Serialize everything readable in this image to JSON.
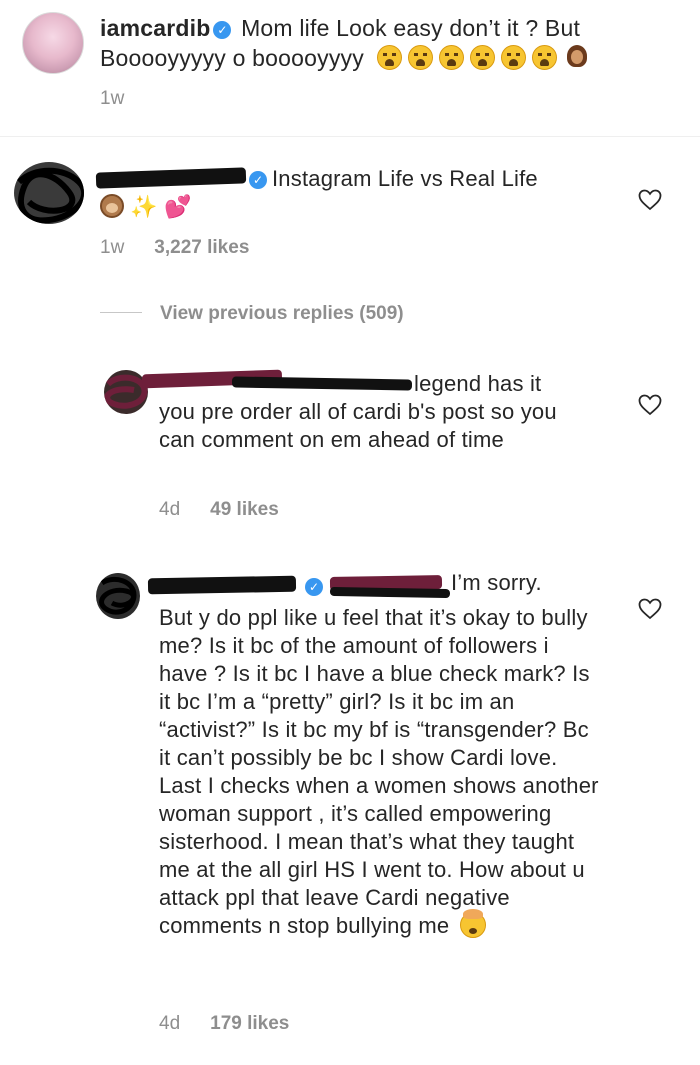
{
  "post": {
    "username": "iamcardib",
    "caption": "Mom life Look easy don’t it ? But Booooyyyyy o booooyyyy",
    "time": "1w"
  },
  "comments": [
    {
      "text": "Instagram Life vs Real Life",
      "time": "1w",
      "likes": "3,227 likes"
    }
  ],
  "view_previous_replies": "View previous replies (509)",
  "replies": [
    {
      "text_line1": "legend has it",
      "text_rest": "you pre order all of cardi b's post so you can comment on em ahead of time",
      "time": "4d",
      "likes": "49 likes"
    },
    {
      "text_line1": "I’m sorry.",
      "text_rest": "But y do ppl like u feel that it’s okay to bully me? Is it bc of the amount of followers i have ? Is it bc I have a blue check mark? Is it bc I’m a “pretty” girl? Is it bc im an “activist?” Is it bc my bf is “transgender? Bc it can’t possibly be bc I show Cardi love. Last I checks when a women shows another woman support , it’s called empowering sisterhood. I mean that’s what they taught me at the all girl HS I went to. How about u attack ppl that leave Cardi negative comments n stop bullying me",
      "time": "4d",
      "likes": "179 likes"
    }
  ],
  "icons": {
    "verified": "verified-badge-icon",
    "heart": "heart-outline-icon"
  },
  "colors": {
    "verified": "#3897f0",
    "meta_text": "#8e8e8e",
    "text": "#262626"
  }
}
